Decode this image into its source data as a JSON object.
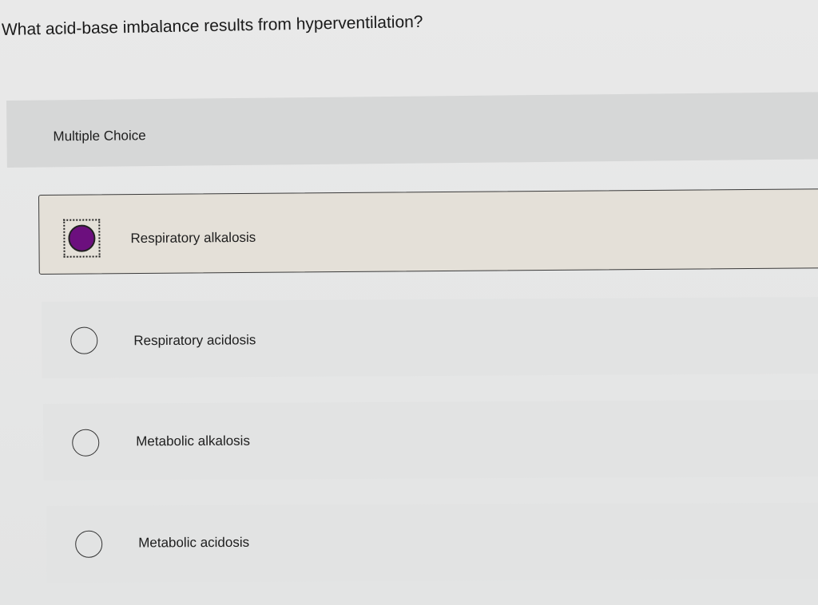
{
  "question": {
    "text": "What acid-base imbalance results from hyperventilation?"
  },
  "section": {
    "label": "Multiple Choice"
  },
  "options": [
    {
      "label": "Respiratory alkalosis",
      "selected": true
    },
    {
      "label": "Respiratory acidosis",
      "selected": false
    },
    {
      "label": "Metabolic alkalosis",
      "selected": false
    },
    {
      "label": "Metabolic acidosis",
      "selected": false
    }
  ],
  "colors": {
    "selected_radio": "#6c0f7e",
    "selected_row_bg": "#e4e0d8",
    "row_bg": "#e2e3e3",
    "header_bg": "#d6d7d7"
  }
}
